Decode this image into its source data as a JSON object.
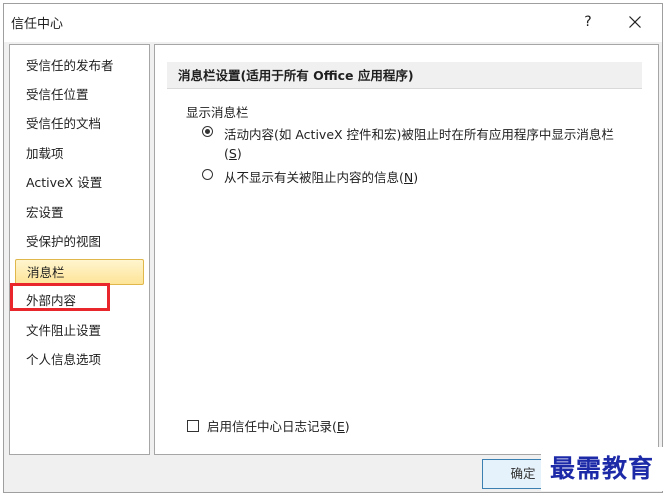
{
  "dialog": {
    "title": "信任中心",
    "help_label": "?"
  },
  "sidebar": {
    "items": [
      {
        "label": "受信任的发布者"
      },
      {
        "label": "受信任位置"
      },
      {
        "label": "受信任的文档"
      },
      {
        "label": "加载项"
      },
      {
        "label": "ActiveX 设置"
      },
      {
        "label": "宏设置"
      },
      {
        "label": "受保护的视图"
      },
      {
        "label": "消息栏",
        "selected": true
      },
      {
        "label": "外部内容",
        "highlighted": true
      },
      {
        "label": "文件阻止设置"
      },
      {
        "label": "个人信息选项"
      }
    ]
  },
  "main": {
    "section_title": "消息栏设置(适用于所有 Office 应用程序)",
    "group_label": "显示消息栏",
    "option1": {
      "line1": "活动内容(如 ActiveX 控件和宏)被阻止时在所有应用程序中显示消息栏",
      "line2_prefix": "(",
      "accel": "S",
      "line2_suffix": ")",
      "checked": true
    },
    "option2": {
      "text": "从不显示有关被阻止内容的信息(",
      "accel": "N",
      "suffix": ")",
      "checked": false
    },
    "log_checkbox": {
      "text": "启用信任中心日志记录(",
      "accel": "E",
      "suffix": ")",
      "checked": false
    }
  },
  "footer": {
    "ok_label": "确定"
  },
  "watermark": "最需教育",
  "colors": {
    "selected_bg": "#fde497",
    "highlight_border": "#e8262c",
    "watermark_text": "#1d2aa8"
  }
}
